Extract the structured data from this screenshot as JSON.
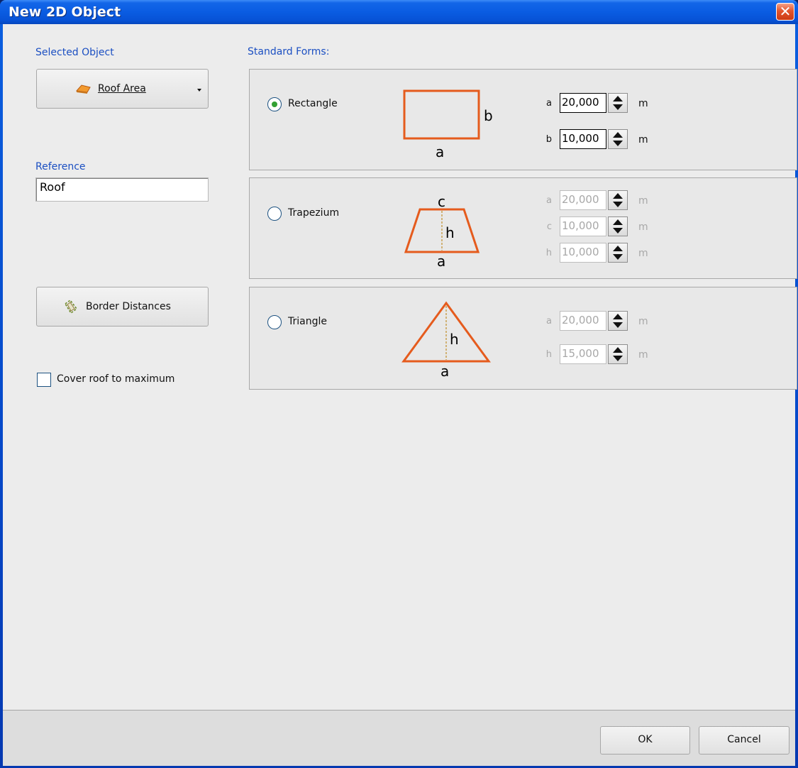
{
  "window": {
    "title": "New 2D Object",
    "close_symbol": "✕"
  },
  "left": {
    "selected_object_label": "Selected Object",
    "selected_object_value": "Roof Area",
    "reference_label": "Reference",
    "reference_value": "Roof",
    "border_distances_label": "Border Distances",
    "cover_roof_label": "Cover roof to maximum",
    "cover_roof_checked": false
  },
  "standard_forms": {
    "label": "Standard Forms:",
    "accent_color": "#e55b1d",
    "rectangle": {
      "label": "Rectangle",
      "selected": true,
      "diagram": {
        "side_a": "a",
        "side_b": "b"
      },
      "fields": [
        {
          "key": "a",
          "value": "20,000",
          "unit": "m"
        },
        {
          "key": "b",
          "value": "10,000",
          "unit": "m"
        }
      ]
    },
    "trapezium": {
      "label": "Trapezium",
      "selected": false,
      "diagram": {
        "side_a": "a",
        "side_c": "c",
        "height": "h"
      },
      "fields": [
        {
          "key": "a",
          "value": "20,000",
          "unit": "m"
        },
        {
          "key": "c",
          "value": "10,000",
          "unit": "m"
        },
        {
          "key": "h",
          "value": "10,000",
          "unit": "m"
        }
      ]
    },
    "triangle": {
      "label": "Triangle",
      "selected": false,
      "diagram": {
        "side_a": "a",
        "height": "h"
      },
      "fields": [
        {
          "key": "a",
          "value": "20,000",
          "unit": "m"
        },
        {
          "key": "h",
          "value": "15,000",
          "unit": "m"
        }
      ]
    }
  },
  "footer": {
    "ok_label": "OK",
    "cancel_label": "Cancel"
  }
}
